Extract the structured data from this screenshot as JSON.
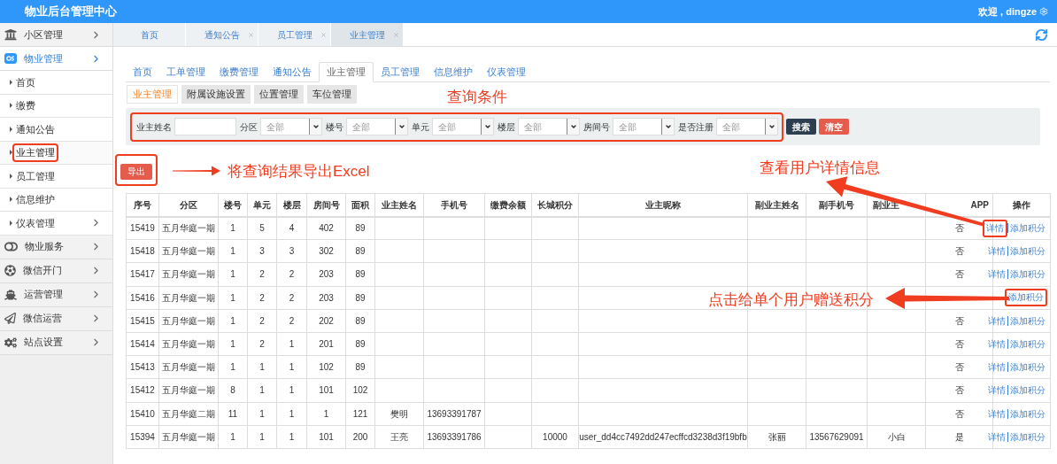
{
  "header": {
    "title": "物业后台管理中心",
    "greeting": "欢迎 , dingze"
  },
  "sidebar": {
    "groups": [
      {
        "label": "小区管理",
        "expanded": false
      },
      {
        "label": "物业管理",
        "expanded": true,
        "children": [
          {
            "label": "首页",
            "selected": false,
            "expandable": false
          },
          {
            "label": "缴费",
            "selected": false,
            "expandable": false
          },
          {
            "label": "通知公告",
            "selected": false,
            "expandable": false
          },
          {
            "label": "业主管理",
            "selected": true,
            "expandable": false,
            "highlighted": true
          },
          {
            "label": "员工管理",
            "selected": false,
            "expandable": false
          },
          {
            "label": "信息维护",
            "selected": false,
            "expandable": false
          },
          {
            "label": "仪表管理",
            "selected": false,
            "expandable": true
          }
        ]
      },
      {
        "label": "物业服务",
        "expanded": false
      },
      {
        "label": "微信开门",
        "expanded": false
      },
      {
        "label": "运营管理",
        "expanded": false
      },
      {
        "label": "微信运营",
        "expanded": false
      },
      {
        "label": "站点设置",
        "expanded": false
      }
    ]
  },
  "page_tabs": [
    {
      "label": "首页",
      "closable": false,
      "selected": false
    },
    {
      "label": "通知公告",
      "closable": true,
      "selected": false
    },
    {
      "label": "员工管理",
      "closable": true,
      "selected": false
    },
    {
      "label": "业主管理",
      "closable": true,
      "selected": true
    }
  ],
  "module_tabs": [
    {
      "label": "首页",
      "selected": false
    },
    {
      "label": "工单管理",
      "selected": false
    },
    {
      "label": "缴费管理",
      "selected": false
    },
    {
      "label": "通知公告",
      "selected": false
    },
    {
      "label": "业主管理",
      "selected": true
    },
    {
      "label": "员工管理",
      "selected": false
    },
    {
      "label": "信息维护",
      "selected": false
    },
    {
      "label": "仪表管理",
      "selected": false
    }
  ],
  "sub_tabs": [
    {
      "label": "业主管理",
      "selected": true
    },
    {
      "label": "附属设施设置",
      "selected": false
    },
    {
      "label": "位置管理",
      "selected": false
    },
    {
      "label": "车位管理",
      "selected": false
    }
  ],
  "filter": {
    "highlighted": true,
    "fields": [
      {
        "label": "业主姓名",
        "kind": "text"
      },
      {
        "label": "分区",
        "kind": "select",
        "value": "全部"
      },
      {
        "label": "楼号",
        "kind": "select",
        "value": "全部"
      },
      {
        "label": "单元",
        "kind": "select",
        "value": "全部"
      },
      {
        "label": "楼层",
        "kind": "select",
        "value": "全部"
      },
      {
        "label": "房间号",
        "kind": "select",
        "value": "全部"
      },
      {
        "label": "是否注册",
        "kind": "select",
        "value": "全部"
      }
    ],
    "search_button": "搜索",
    "clear_button": "清空"
  },
  "export_button": {
    "label": "导出",
    "highlighted": true
  },
  "annotations": [
    {
      "text": "查询条件"
    },
    {
      "text": "将查询结果导出Excel"
    },
    {
      "text": "查看用户详情信息"
    },
    {
      "text": "点击给单个用户赠送积分"
    }
  ],
  "table": {
    "columns": [
      "序号",
      "分区",
      "楼号",
      "单元",
      "楼层",
      "房间号",
      "面积",
      "业主姓名",
      "手机号",
      "缴费余额",
      "长城积分",
      "业主昵称",
      "副业主姓名",
      "副手机号",
      "副业主",
      "APP",
      "操作"
    ],
    "rows": [
      {
        "id": "15419",
        "district": "五月华庭一期",
        "building": "1",
        "unit": "5",
        "floor": "4",
        "room": "402",
        "area": "89",
        "registered": "否",
        "actions": [
          {
            "label": "详情",
            "highlighted": true
          },
          {
            "label": "添加积分",
            "highlighted": false
          }
        ]
      },
      {
        "id": "15418",
        "district": "五月华庭一期",
        "building": "1",
        "unit": "3",
        "floor": "3",
        "room": "302",
        "area": "89",
        "registered": "否",
        "actions": [
          {
            "label": "详情",
            "highlighted": false
          },
          {
            "label": "添加积分",
            "highlighted": false
          }
        ]
      },
      {
        "id": "15417",
        "district": "五月华庭一期",
        "building": "1",
        "unit": "2",
        "floor": "2",
        "room": "203",
        "area": "89",
        "registered": "否",
        "actions": [
          {
            "label": "详情",
            "highlighted": false
          },
          {
            "label": "添加积分",
            "highlighted": false
          }
        ]
      },
      {
        "id": "15416",
        "district": "五月华庭一期",
        "building": "1",
        "unit": "2",
        "floor": "2",
        "room": "203",
        "area": "89",
        "actions": [
          {
            "label": "添加积分",
            "highlighted": true
          }
        ]
      },
      {
        "id": "15415",
        "district": "五月华庭一期",
        "building": "1",
        "unit": "2",
        "floor": "2",
        "room": "202",
        "area": "89",
        "registered": "否",
        "actions": [
          {
            "label": "详情",
            "highlighted": false
          },
          {
            "label": "添加积分",
            "highlighted": false
          }
        ]
      },
      {
        "id": "15414",
        "district": "五月华庭一期",
        "building": "1",
        "unit": "2",
        "floor": "1",
        "room": "201",
        "area": "89",
        "registered": "否",
        "actions": [
          {
            "label": "详情",
            "highlighted": false
          },
          {
            "label": "添加积分",
            "highlighted": false
          }
        ]
      },
      {
        "id": "15413",
        "district": "五月华庭一期",
        "building": "1",
        "unit": "1",
        "floor": "1",
        "room": "102",
        "area": "89",
        "registered": "否",
        "actions": [
          {
            "label": "详情",
            "highlighted": false
          },
          {
            "label": "添加积分",
            "highlighted": false
          }
        ]
      },
      {
        "id": "15412",
        "district": "五月华庭一期",
        "building": "8",
        "unit": "1",
        "floor": "1",
        "room": "101",
        "area": "102",
        "registered": "否",
        "actions": [
          {
            "label": "详情",
            "highlighted": false
          },
          {
            "label": "添加积分",
            "highlighted": false
          }
        ]
      },
      {
        "id": "15410",
        "district": "五月华庭二期",
        "building": "11",
        "unit": "1",
        "floor": "1",
        "room": "1",
        "area": "121",
        "owner_name": "樊明",
        "phone": "13693391787",
        "registered": "否",
        "actions": [
          {
            "label": "详情",
            "highlighted": false
          },
          {
            "label": "添加积分",
            "highlighted": false
          }
        ]
      },
      {
        "id": "15394",
        "district": "五月华庭一期",
        "building": "1",
        "unit": "1",
        "floor": "1",
        "room": "101",
        "area": "200",
        "owner_name": "王亮",
        "phone": "13693391786",
        "points": "10000",
        "nickname": "user_dd4cc7492dd247ecffcd3238d3f19bfb",
        "co_owner_name": "张丽",
        "co_phone": "13567629091",
        "co_nickname": "小白",
        "registered": "是",
        "actions": [
          {
            "label": "详情",
            "highlighted": false
          },
          {
            "label": "添加积分",
            "highlighted": false
          }
        ]
      }
    ]
  }
}
